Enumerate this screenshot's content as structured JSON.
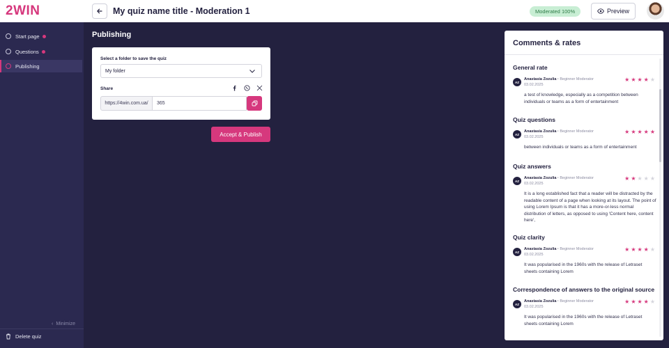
{
  "brand": {
    "logo": "2WIN",
    "accent": "#d6387d"
  },
  "header": {
    "title": "My quiz name title - Moderation 1",
    "moderation_badge": "Moderated 100%",
    "preview_label": "Preview"
  },
  "sidebar": {
    "items": [
      {
        "label": "Start page",
        "badge": true
      },
      {
        "label": "Questions",
        "badge": true
      },
      {
        "label": "Publishing",
        "badge": false,
        "active": true
      }
    ],
    "minimize_label": "Minimize",
    "delete_label": "Delete quiz"
  },
  "publishing": {
    "heading": "Publishing",
    "folder_label": "Select a folder to save the quiz",
    "folder_value": "My folder",
    "share_label": "Share",
    "share_icons": [
      "facebook-icon",
      "whatsapp-icon",
      "x-icon"
    ],
    "url_prefix": "https://4win.com.ua/",
    "url_value": "365",
    "publish_button": "Accept & Publish"
  },
  "comments": {
    "title": "Comments & rates",
    "sections": [
      {
        "title": "General rate",
        "initials": "AZ",
        "name": "Anastasia Zozulia",
        "role": "Beginner Moderator",
        "date": "03.02.2025",
        "rating": 4,
        "text": "a test of knowledge, especially as a competition between individuals or teams as a form of entertainment"
      },
      {
        "title": "Quiz questions",
        "initials": "AZ",
        "name": "Anastasia Zozulia",
        "role": "Beginner Moderator",
        "date": "03.02.2025",
        "rating": 5,
        "text": "between individuals or teams as a form of entertainment"
      },
      {
        "title": "Quiz answers",
        "initials": "AZ",
        "name": "Anastasia Zozulia",
        "role": "Beginner Moderator",
        "date": "03.02.2025",
        "rating": 2,
        "text": "It is a long established fact that a reader will be distracted by the readable content of a page when looking at its layout. The point of using Lorem Ipsum is that it has a more-or-less normal distribution of letters, as opposed to using 'Content here, content here',"
      },
      {
        "title": "Quiz clarity",
        "initials": "AZ",
        "name": "Anastasia Zozulia",
        "role": "Beginner Moderator",
        "date": "03.02.2025",
        "rating": 4,
        "text": "It was popularised in the 1960s with the release of Letraset sheets containing Lorem"
      },
      {
        "title": "Correspondence of answers to the original source",
        "initials": "AZ",
        "name": "Anastasia Zozulia",
        "role": "Beginner Moderator",
        "date": "03.02.2025",
        "rating": 4,
        "text": "It was popularised in the 1960s with the release of Letraset sheets containing Lorem"
      }
    ]
  }
}
